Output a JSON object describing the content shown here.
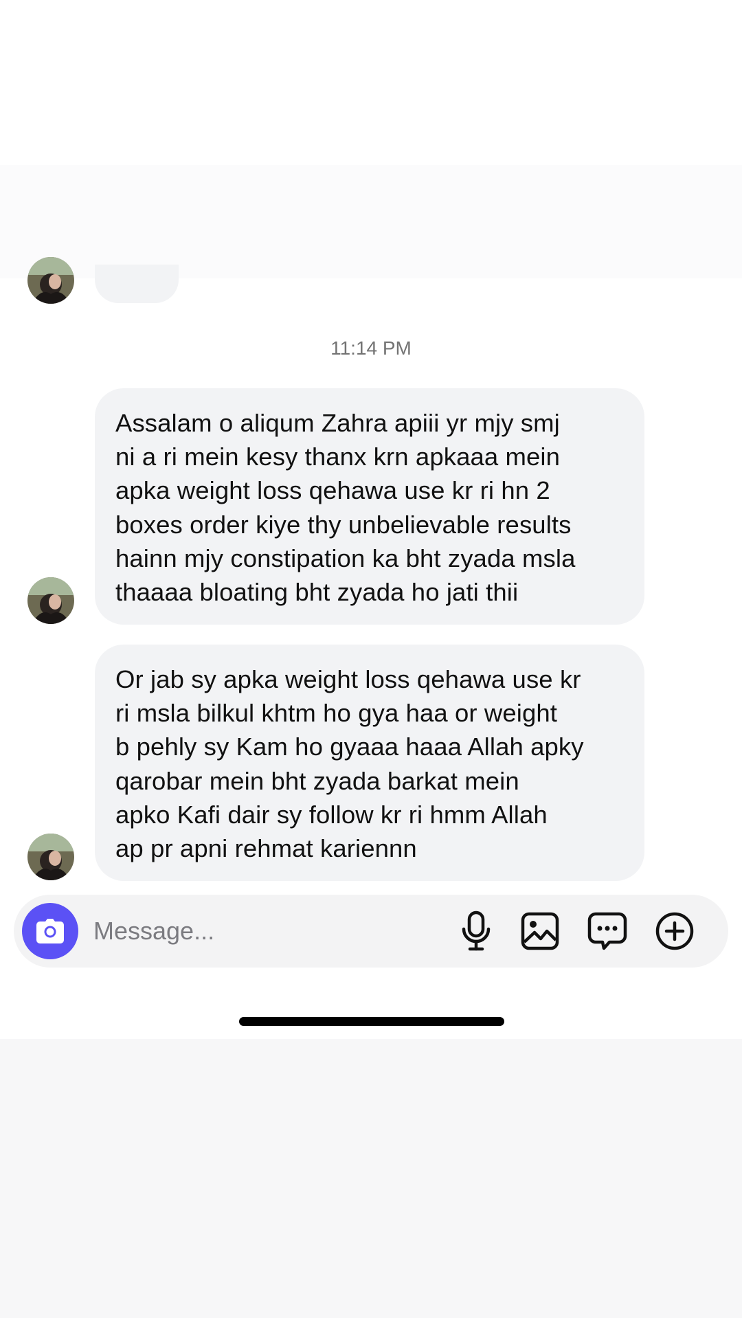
{
  "thread": {
    "timestamp": "11:14 PM",
    "messages": [
      {
        "lines": [
          "Assalam o aliqum Zahra apiii yr mjy smj",
          "ni a ri mein kesy thanx krn apkaaa mein",
          "apka weight loss qehawa use kr ri hn 2",
          "boxes order kiye thy unbelievable results",
          "hainn mjy constipation ka bht zyada msla",
          "thaaaa bloating bht zyada ho jati thii"
        ]
      },
      {
        "lines": [
          "Or jab sy apka weight loss qehawa use kr",
          "ri msla bilkul khtm ho gya haa or weight",
          "b pehly sy Kam ho gyaaa haaa Allah apky",
          "qarobar mein bht zyada barkat mein",
          "apko Kafi dair sy follow kr ri hmm Allah",
          "ap pr apni rehmat kariennn"
        ]
      }
    ]
  },
  "composer": {
    "placeholder": "Message...",
    "icons": {
      "camera": "camera-icon",
      "mic": "microphone-icon",
      "gallery": "image-icon",
      "sticker": "chat-bubble-icon",
      "more": "plus-circle-icon"
    },
    "camera_color": "#5b51f5"
  },
  "colors": {
    "bubble_bg": "#f2f3f5",
    "composer_bg": "#f3f3f4",
    "timestamp": "#737373"
  }
}
